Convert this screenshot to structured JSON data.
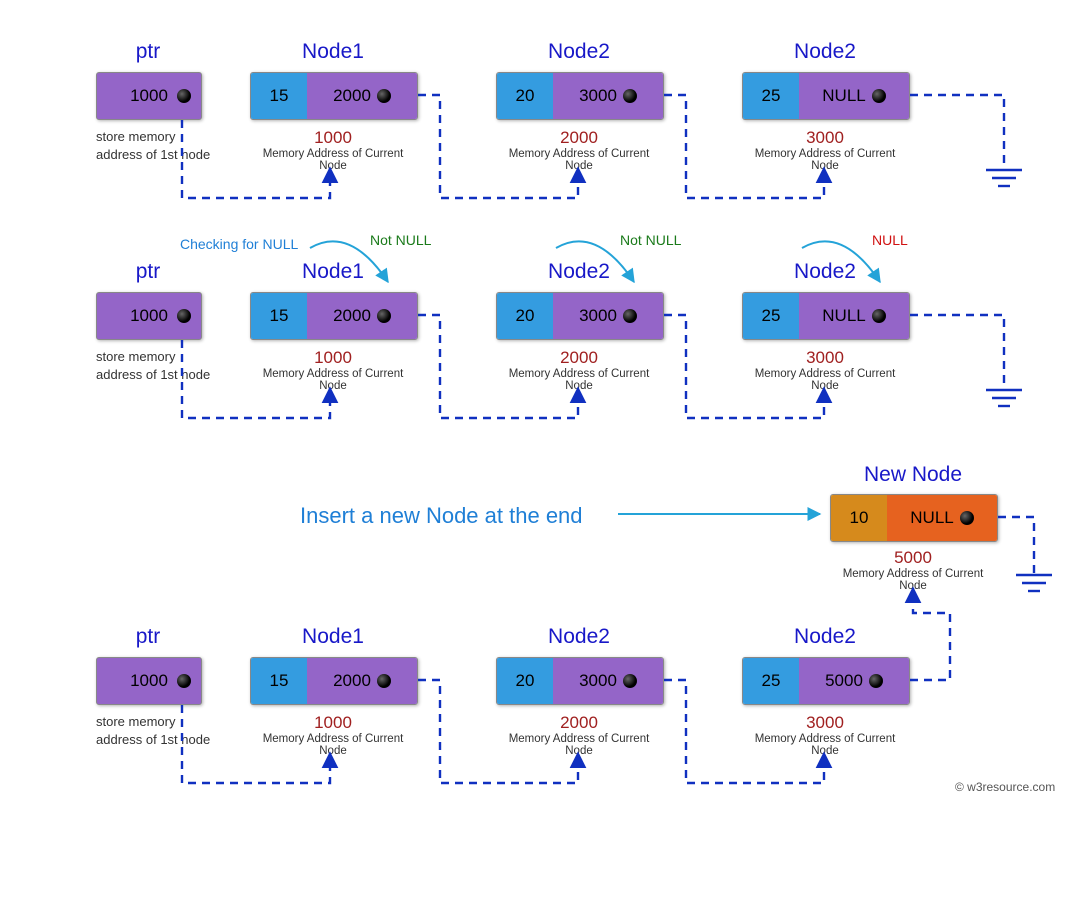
{
  "ptr_label": "ptr",
  "ptr_value": "1000",
  "ptr_caption": "store memory address of 1st node",
  "nodes": [
    {
      "title": "Node1",
      "data": "15",
      "ptr": "2000",
      "addr": "1000"
    },
    {
      "title": "Node2",
      "data": "20",
      "ptr": "3000",
      "addr": "2000"
    },
    {
      "title": "Node2",
      "data": "25",
      "ptr": "NULL",
      "addr": "3000"
    }
  ],
  "memcap": "Memory Address of Current Node",
  "checking": "Checking for NULL",
  "notnull": "Not NULL",
  "null": "NULL",
  "newnode": {
    "title": "New Node",
    "data": "10",
    "ptr": "NULL",
    "addr": "5000"
  },
  "insert": "Insert a new Node at the end",
  "row3": {
    "nodes": [
      {
        "title": "Node1",
        "data": "15",
        "ptr": "2000",
        "addr": "1000"
      },
      {
        "title": "Node2",
        "data": "20",
        "ptr": "3000",
        "addr": "2000"
      },
      {
        "title": "Node2",
        "data": "25",
        "ptr": "5000",
        "addr": "3000"
      }
    ]
  },
  "copyright": "© w3resource.com"
}
